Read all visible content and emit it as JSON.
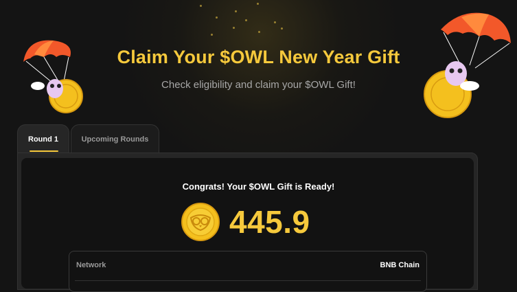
{
  "header": {
    "title": "Claim Your $OWL New Year Gift",
    "subtitle": "Check eligibility and claim your $OWL Gift!"
  },
  "tabs": [
    {
      "label": "Round 1",
      "active": true
    },
    {
      "label": "Upcoming Rounds",
      "active": false
    }
  ],
  "gift": {
    "congrats_text": "Congrats! Your $OWL Gift is Ready!",
    "amount": "445.9",
    "coin_icon": "owl-coin-icon"
  },
  "details": {
    "network_label": "Network",
    "network_value": "BNB Chain"
  },
  "colors": {
    "accent": "#f6c93c",
    "background": "#141414",
    "panel": "#262626",
    "parachute": "#f2582a"
  },
  "decorations": {
    "left_icon": "parachute-owl-coin-icon",
    "right_icon": "parachute-owl-coin-icon"
  }
}
